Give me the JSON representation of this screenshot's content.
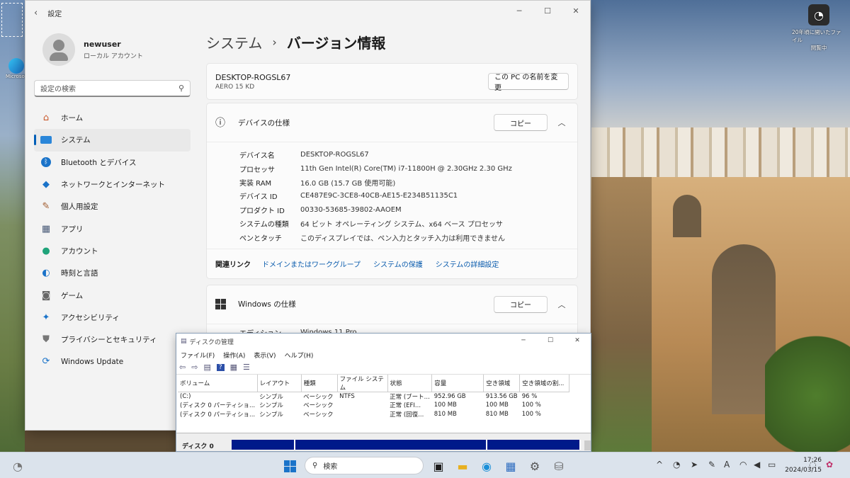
{
  "colors": {
    "accent": "#005fb8",
    "link": "#0b5cad",
    "disk_partition": "#001a8a"
  },
  "desktop": {
    "icons": [
      {
        "label": "",
        "icon": "recycle-bin-icon"
      },
      {
        "label": "Microsoft Edge",
        "icon": "edge-icon"
      }
    ],
    "right_widget": {
      "label": "20年頃に開いたファイル",
      "sub": "閲覧中",
      "icon": "camera-roll-icon"
    }
  },
  "settings": {
    "title": "設定",
    "user": {
      "name": "newuser",
      "role": "ローカル アカウント"
    },
    "search_placeholder": "設定の検索",
    "nav": [
      {
        "label": "ホーム",
        "icon": "home-icon"
      },
      {
        "label": "システム",
        "icon": "system-icon",
        "selected": true
      },
      {
        "label": "Bluetooth とデバイス",
        "icon": "bluetooth-icon"
      },
      {
        "label": "ネットワークとインターネット",
        "icon": "network-icon"
      },
      {
        "label": "個人用設定",
        "icon": "brush-icon"
      },
      {
        "label": "アプリ",
        "icon": "apps-icon"
      },
      {
        "label": "アカウント",
        "icon": "account-icon"
      },
      {
        "label": "時刻と言語",
        "icon": "globe-clock-icon"
      },
      {
        "label": "ゲーム",
        "icon": "gamepad-icon"
      },
      {
        "label": "アクセシビリティ",
        "icon": "accessibility-icon"
      },
      {
        "label": "プライバシーとセキュリティ",
        "icon": "shield-icon"
      },
      {
        "label": "Windows Update",
        "icon": "update-icon"
      }
    ],
    "breadcrumb": {
      "parent": "システム",
      "sep": "›",
      "current": "バージョン情報"
    },
    "device": {
      "name": "DESKTOP-ROGSL67",
      "model": "AERO 15 KD",
      "rename_label": "この PC の名前を変更"
    },
    "device_specs": {
      "title": "デバイスの仕様",
      "copy_label": "コピー",
      "rows": [
        {
          "k": "デバイス名",
          "v": "DESKTOP-ROGSL67"
        },
        {
          "k": "プロセッサ",
          "v": "11th Gen Intel(R) Core(TM) i7-11800H @ 2.30GHz   2.30 GHz"
        },
        {
          "k": "実装 RAM",
          "v": "16.0 GB (15.7 GB 使用可能)"
        },
        {
          "k": "デバイス ID",
          "v": "CE487E9C-3CE8-40CB-AE15-E234B51135C1"
        },
        {
          "k": "プロダクト ID",
          "v": "00330-53685-39802-AAOEM"
        },
        {
          "k": "システムの種類",
          "v": "64 ビット オペレーティング システム、x64 ベース プロセッサ"
        },
        {
          "k": "ペンとタッチ",
          "v": "このディスプレイでは、ペン入力とタッチ入力は利用できません"
        }
      ]
    },
    "related": {
      "label": "関連リンク",
      "links": [
        "ドメインまたはワークグループ",
        "システムの保護",
        "システムの詳細設定"
      ]
    },
    "windows_specs": {
      "title": "Windows の仕様",
      "copy_label": "コピー",
      "rows": [
        {
          "k": "エディション",
          "v": "Windows 11 Pro"
        }
      ]
    }
  },
  "disk_mgmt": {
    "title": "ディスクの管理",
    "menu": [
      "ファイル(F)",
      "操作(A)",
      "表示(V)",
      "ヘルプ(H)"
    ],
    "columns": [
      "ボリューム",
      "レイアウト",
      "種類",
      "ファイル システム",
      "状態",
      "容量",
      "空き領域",
      "空き領域の割..."
    ],
    "rows": [
      [
        "(C:)",
        "シンプル",
        "ベーシック",
        "NTFS",
        "正常 (ブート...",
        "952.96 GB",
        "913.56 GB",
        "96 %"
      ],
      [
        "(ディスク 0 パーティショ...",
        "シンプル",
        "ベーシック",
        "",
        "正常 (EFI...",
        "100 MB",
        "100 MB",
        "100 %"
      ],
      [
        "(ディスク 0 パーティショ...",
        "シンプル",
        "ベーシック",
        "",
        "正常 (回復...",
        "810 MB",
        "810 MB",
        "100 %"
      ]
    ],
    "disk_label": "ディスク 0"
  },
  "taskbar": {
    "search": "検索",
    "time": "17:26",
    "date": "2024/03/15"
  }
}
